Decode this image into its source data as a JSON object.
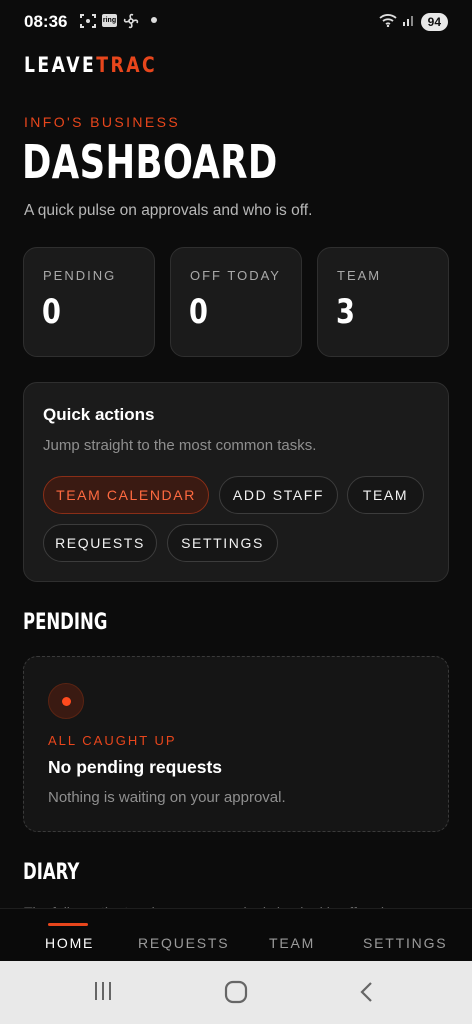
{
  "status_bar": {
    "time": "08:36",
    "ring_label": "ring",
    "battery": "94"
  },
  "brand": {
    "part1": "LEAVE",
    "part2": "TRAC",
    "accent_color": "#e8461c"
  },
  "header": {
    "eyebrow": "INFO'S BUSINESS",
    "title": "DASHBOARD",
    "subtitle": "A quick pulse on approvals and who is off."
  },
  "stats": [
    {
      "label": "PENDING",
      "value": "0"
    },
    {
      "label": "OFF TODAY",
      "value": "0"
    },
    {
      "label": "TEAM",
      "value": "3"
    }
  ],
  "quick_actions": {
    "title": "Quick actions",
    "subtitle": "Jump straight to the most common tasks.",
    "buttons": [
      {
        "label": "TEAM CALENDAR",
        "active": true
      },
      {
        "label": "ADD STAFF"
      },
      {
        "label": "TEAM"
      },
      {
        "label": "REQUESTS"
      },
      {
        "label": "SETTINGS"
      }
    ]
  },
  "pending": {
    "section_title": "PENDING",
    "eyebrow": "ALL CAUGHT UP",
    "title": "No pending requests",
    "subtitle": "Nothing is waiting on your approval."
  },
  "diary": {
    "section_title": "DIARY",
    "text": "The full month at a glance — see who is booked in off and..."
  },
  "bottom_nav": {
    "items": [
      {
        "label": "HOME",
        "active": true
      },
      {
        "label": "REQUESTS"
      },
      {
        "label": "TEAM"
      },
      {
        "label": "SETTINGS"
      }
    ]
  },
  "icons": {
    "screenshot": "screenshot-icon",
    "ring": "ring-app-icon",
    "fan": "fan-icon",
    "wifi": "wifi-icon",
    "signal": "signal-icon",
    "recents": "recents-icon",
    "home": "home-circle-icon",
    "back": "back-chevron-icon"
  }
}
